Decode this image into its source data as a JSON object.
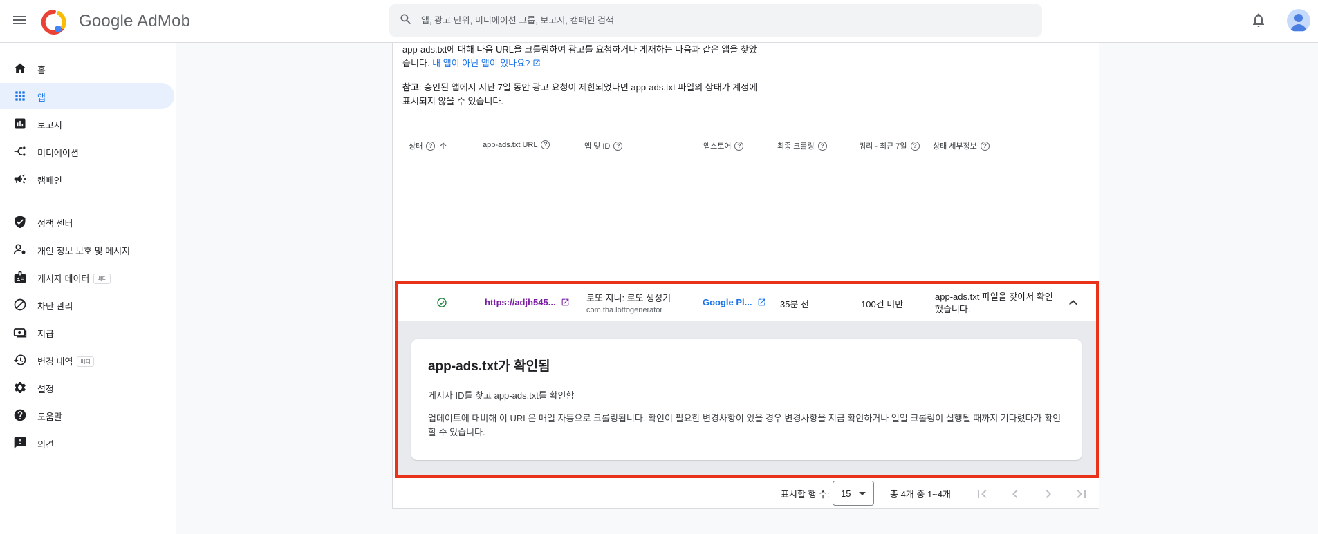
{
  "header": {
    "brand": "Google AdMob",
    "search_placeholder": "앱, 광고 단위, 미디에이션 그룹, 보고서, 캠페인 검색"
  },
  "sidebar": {
    "items": [
      {
        "label": "홈",
        "icon": "home-icon"
      },
      {
        "label": "앱",
        "icon": "apps-grid-icon",
        "active": true
      },
      {
        "label": "보고서",
        "icon": "bar-chart-icon"
      },
      {
        "label": "미디에이션",
        "icon": "mediation-icon"
      },
      {
        "label": "캠페인",
        "icon": "megaphone-icon"
      },
      {
        "label": "정책 센터",
        "icon": "shield-icon"
      },
      {
        "label": "개인 정보 보호 및 메시지",
        "icon": "person-settings-icon"
      },
      {
        "label": "게시자 데이터",
        "icon": "badge-icon",
        "badge": "베타"
      },
      {
        "label": "차단 관리",
        "icon": "block-icon"
      },
      {
        "label": "지급",
        "icon": "payments-icon"
      },
      {
        "label": "변경 내역",
        "icon": "history-icon",
        "badge": "베타"
      },
      {
        "label": "설정",
        "icon": "gear-icon"
      },
      {
        "label": "도움말",
        "icon": "help-icon"
      },
      {
        "label": "의견",
        "icon": "feedback-icon"
      }
    ]
  },
  "content": {
    "intro_text": "app-ads.txt에 대해 다음 URL을 크롤링하여 광고를 요청하거나 게재하는 다음과 같은 앱을 찾았습니다.",
    "intro_link": "내 앱이 아닌 앱이 있나요?",
    "note_label": "참고",
    "note_text": ": 승인된 앱에서 지난 7일 동안 광고 요청이 제한되었다면 app-ads.txt 파일의 상태가 계정에 표시되지 않을 수 있습니다."
  },
  "table": {
    "headers": [
      "상태",
      "app-ads.txt URL",
      "앱 및 ID",
      "앱스토어",
      "최종 크롤링",
      "쿼리 - 최근 7일",
      "상태 세부정보"
    ],
    "row": {
      "url": "https://adjh545...",
      "app_name": "로또 지니: 로또 생성기",
      "app_id": "com.tha.lottogenerator",
      "store": "Google Pl...",
      "last_crawl": "35분 전",
      "queries": "100건 미만",
      "status_detail_1": "app-ads.txt 파일을 찾아서 확인",
      "status_detail_2": "했습니다."
    },
    "detail": {
      "title": "app-ads.txt가 확인됨",
      "line1": "게시자 ID를 찾고 app-ads.txt를 확인함",
      "line2": "업데이트에 대비해 이 URL은 매일 자동으로 크롤링됩니다. 확인이 필요한 변경사항이 있을 경우 변경사항을 지금 확인하거나 일일 크롤링이 실행될 때까지 기다렸다가 확인할 수 있습니다."
    }
  },
  "pagination": {
    "rows_label": "표시할 행 수:",
    "rows_value": "15",
    "range_text": "총 4개 중 1~4개"
  },
  "colors": {
    "accent": "#1a73e8",
    "highlight": "#e8331a",
    "success": "#188038"
  }
}
